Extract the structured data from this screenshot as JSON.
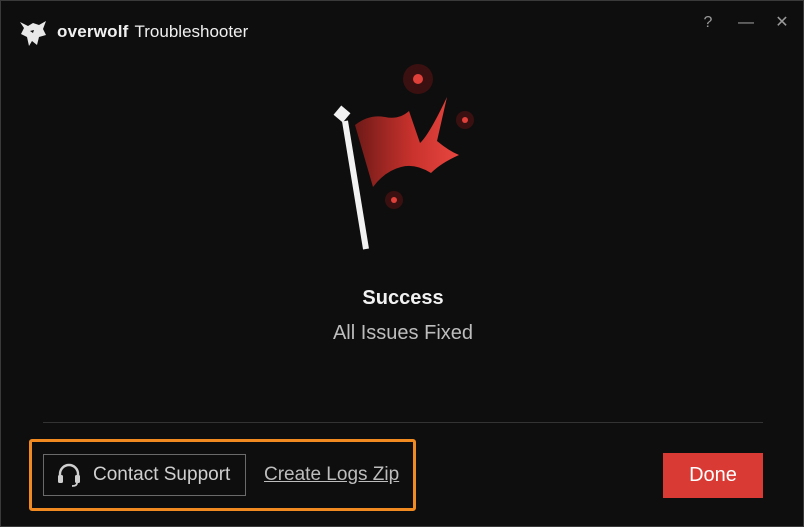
{
  "titlebar": {
    "brand_name": "overwolf",
    "app_name": "Troubleshooter",
    "help_label": "?",
    "minimize_label": "—",
    "close_label": "✕",
    "logo_icon": "wolf-logo-icon"
  },
  "illustration": {
    "icon": "flag-icon",
    "flag_color": "#e0403a"
  },
  "status": {
    "title": "Success",
    "subtitle": "All Issues Fixed"
  },
  "footer": {
    "contact_label": "Contact Support",
    "contact_icon": "headset-icon",
    "logs_label": "Create Logs Zip",
    "done_label": "Done",
    "highlight_color": "#f28a22",
    "done_color": "#d93a34"
  }
}
